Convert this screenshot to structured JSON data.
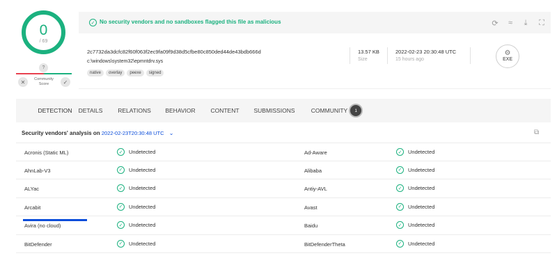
{
  "score": {
    "detected": "0",
    "total": "/ 69"
  },
  "community": {
    "question": "?",
    "label": "Community Score",
    "down_icon": "x-icon",
    "up_icon": "check-icon"
  },
  "banner": {
    "text": "No security vendors and no sandboxes flagged this file as malicious"
  },
  "file": {
    "hash": "2c7732da3dcfc82f60f063f2ec9fa09f9d38d5cfbe80c850ded44de43bdb666d",
    "path": "c:\\windows\\system32\\epmntdrv.sys",
    "tags": [
      "native",
      "overlay",
      "peexe",
      "signed"
    ],
    "size": "13.57 KB",
    "size_label": "Size",
    "date": "2022-02-23 20:30:48 UTC",
    "date_relative": "15 hours ago",
    "type": "EXE"
  },
  "tabs": [
    {
      "label": "DETECTION"
    },
    {
      "label": "DETAILS"
    },
    {
      "label": "RELATIONS"
    },
    {
      "label": "BEHAVIOR"
    },
    {
      "label": "CONTENT"
    },
    {
      "label": "SUBMISSIONS"
    },
    {
      "label": "COMMUNITY",
      "badge": "1"
    }
  ],
  "analysis": {
    "title": "Security vendors' analysis on",
    "date": "2022-02-23T20:30:48 UTC"
  },
  "vendors": [
    {
      "left": "Acronis (Static ML)",
      "left_result": "Undetected",
      "right": "Ad-Aware",
      "right_result": "Undetected"
    },
    {
      "left": "AhnLab-V3",
      "left_result": "Undetected",
      "right": "Alibaba",
      "right_result": "Undetected"
    },
    {
      "left": "ALYac",
      "left_result": "Undetected",
      "right": "Antiy-AVL",
      "right_result": "Undetected"
    },
    {
      "left": "Arcabit",
      "left_result": "Undetected",
      "right": "Avast",
      "right_result": "Undetected"
    },
    {
      "left": "Avira (no cloud)",
      "left_result": "Undetected",
      "right": "Baidu",
      "right_result": "Undetected"
    },
    {
      "left": "BitDefender",
      "left_result": "Undetected",
      "right": "BitDefenderTheta",
      "right_result": "Undetected"
    }
  ],
  "colors": {
    "clean": "#1bb17f",
    "malicious": "#e8414f",
    "accent": "#0b4dda"
  }
}
